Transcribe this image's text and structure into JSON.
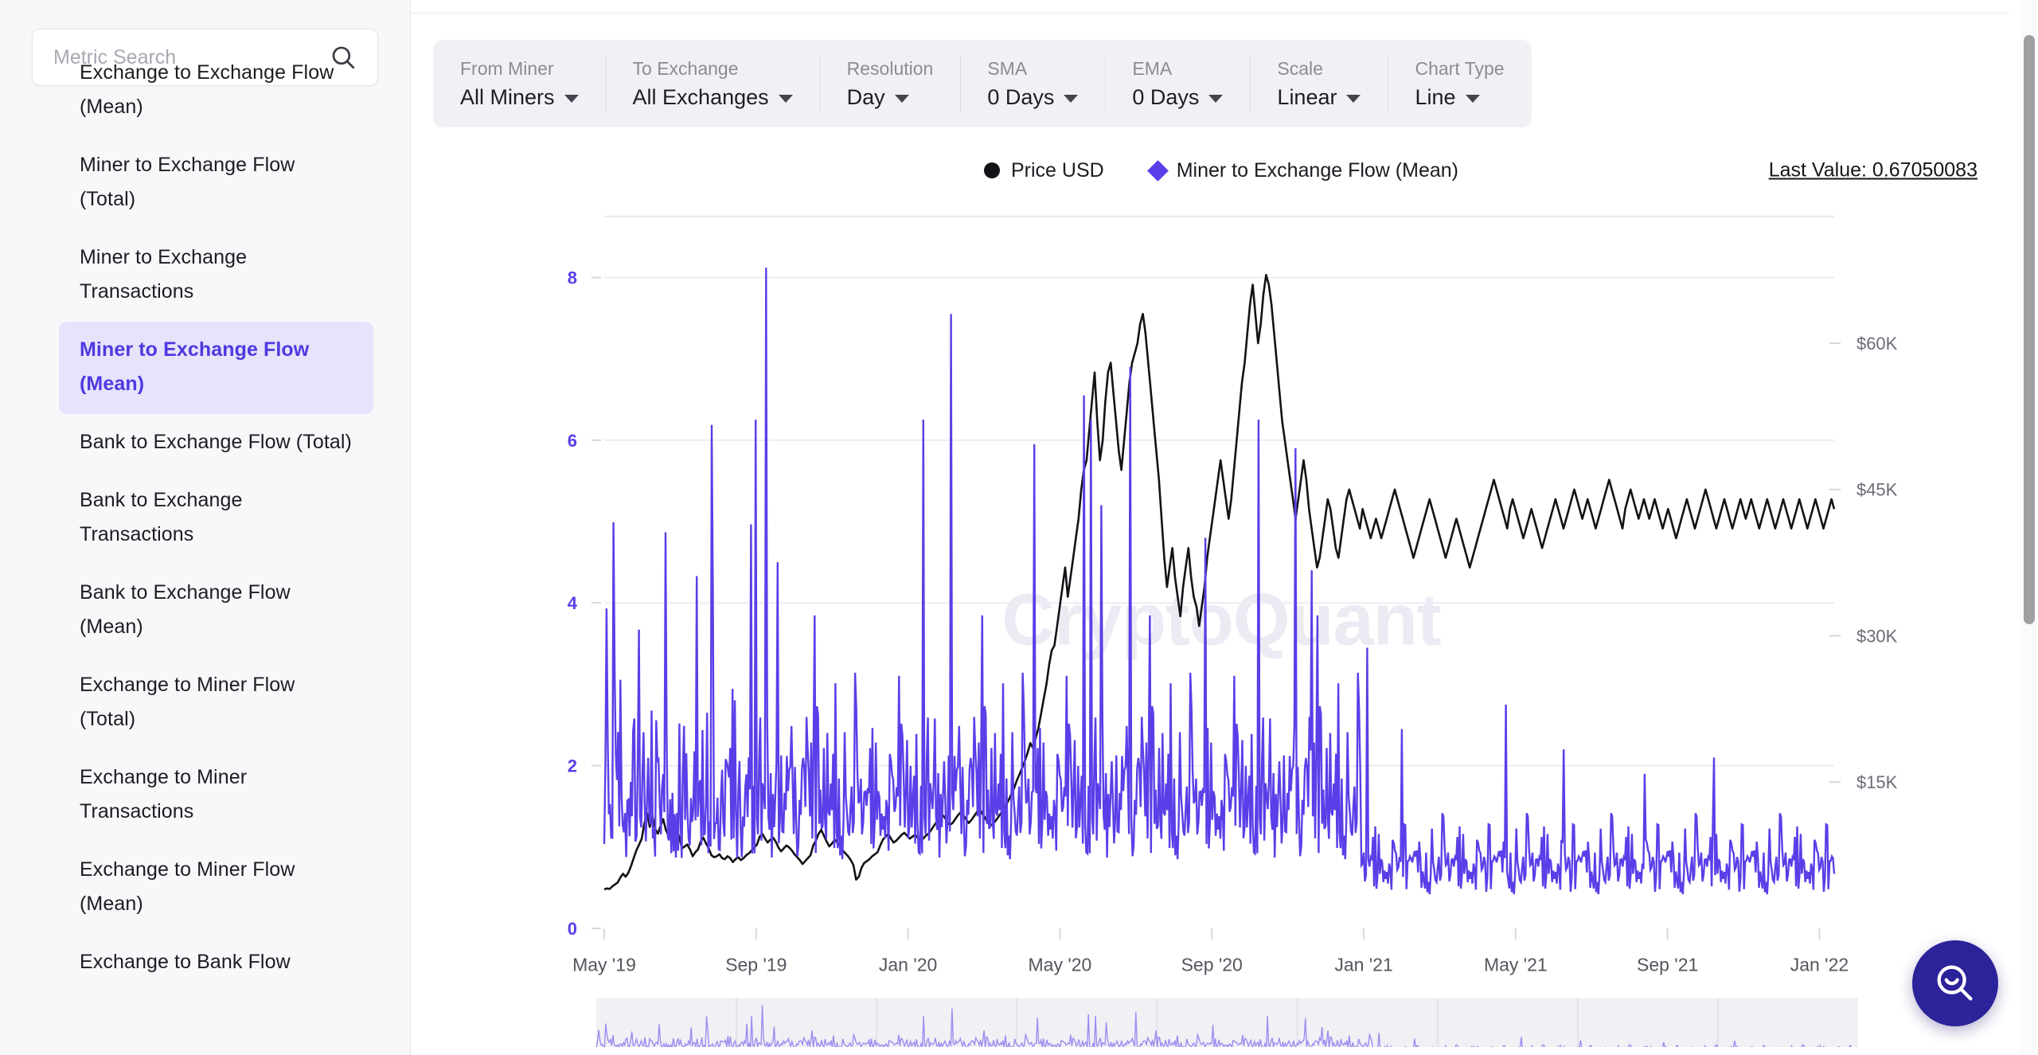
{
  "sidebar": {
    "search": {
      "placeholder": "Metric Search",
      "value": "",
      "icon": "search-icon"
    },
    "items": [
      {
        "label": "Exchange to Exchange Flow (Mean)",
        "selected": false,
        "clipped": true
      },
      {
        "label": "Miner to Exchange Flow (Total)",
        "selected": false
      },
      {
        "label": "Miner to Exchange Transactions",
        "selected": false
      },
      {
        "label": "Miner to Exchange Flow (Mean)",
        "selected": true
      },
      {
        "label": "Bank to Exchange Flow (Total)",
        "selected": false
      },
      {
        "label": "Bank to Exchange Transactions",
        "selected": false
      },
      {
        "label": "Bank to Exchange Flow (Mean)",
        "selected": false
      },
      {
        "label": "Exchange to Miner Flow (Total)",
        "selected": false
      },
      {
        "label": "Exchange to Miner Transactions",
        "selected": false
      },
      {
        "label": "Exchange to Miner Flow (Mean)",
        "selected": false
      },
      {
        "label": "Exchange to Bank Flow",
        "selected": false
      }
    ]
  },
  "toolbar": {
    "controls": [
      {
        "label": "From Miner",
        "value": "All Miners"
      },
      {
        "label": "To Exchange",
        "value": "All Exchanges"
      },
      {
        "label": "Resolution",
        "value": "Day"
      },
      {
        "label": "SMA",
        "value": "0 Days"
      },
      {
        "label": "EMA",
        "value": "0 Days"
      },
      {
        "label": "Scale",
        "value": "Linear"
      },
      {
        "label": "Chart Type",
        "value": "Line"
      }
    ]
  },
  "chart_header": {
    "legend": [
      {
        "name": "Price USD",
        "marker": "circle",
        "color": "#121217"
      },
      {
        "name": "Miner to Exchange Flow (Mean)",
        "marker": "diamond",
        "color": "#5b3ee8"
      }
    ],
    "last_value": "Last Value: 0.67050083",
    "watermark": "CryptoQuant"
  },
  "fab": {
    "icon": "search-smile-icon",
    "color": "#2c2299"
  },
  "chart_data": {
    "type": "line",
    "title": "",
    "subtitle": "",
    "xlabel": "",
    "grid": true,
    "legend_position": "top-center",
    "x_ticks": [
      "May '19",
      "Sep '19",
      "Jan '20",
      "May '20",
      "Sep '20",
      "Jan '21",
      "May '21",
      "Sep '21",
      "Jan '22"
    ],
    "x_tick_positions": [
      0.0,
      0.1235,
      0.247,
      0.3705,
      0.494,
      0.6175,
      0.741,
      0.8645,
      0.988
    ],
    "axes": [
      {
        "side": "left",
        "label": "Miner to Exchange Flow (Mean)",
        "ticks": [
          0,
          2,
          4,
          6,
          8
        ],
        "ylim": [
          0,
          8.75
        ],
        "color": "#5b3ee8"
      },
      {
        "side": "right",
        "label": "Price USD",
        "ticks": [
          "$15K",
          "$30K",
          "$45K",
          "$60K"
        ],
        "tick_values": [
          15000,
          30000,
          45000,
          60000
        ],
        "ylim": [
          0,
          73000
        ],
        "color": "#6b6b78"
      }
    ],
    "series": [
      {
        "name": "Price USD",
        "axis": "right",
        "color": "#121217",
        "marker": "circle",
        "type": "line",
        "values": [
          4000,
          4100,
          4050,
          4300,
          4500,
          4700,
          5200,
          5600,
          5300,
          5700,
          6400,
          7200,
          8000,
          8600,
          9200,
          10800,
          11800,
          10400,
          11500,
          10200,
          9700,
          10500,
          11200,
          10100,
          9500,
          10300,
          9900,
          10100,
          9400,
          8200,
          8400,
          8600,
          8100,
          7400,
          7800,
          8100,
          8900,
          9300,
          8700,
          8200,
          7500,
          7300,
          7400,
          7600,
          7200,
          7100,
          7400,
          7200,
          6800,
          7100,
          7300,
          7000,
          7200,
          7500,
          7700,
          8000,
          8300,
          8600,
          9400,
          9700,
          9200,
          8800,
          9100,
          9300,
          8900,
          8300,
          7900,
          8200,
          8500,
          8300,
          8000,
          7600,
          7300,
          7000,
          6600,
          6900,
          7200,
          7500,
          8500,
          9000,
          9700,
          10100,
          9500,
          8900,
          8400,
          8700,
          9100,
          8800,
          8500,
          8000,
          7700,
          7400,
          7000,
          6500,
          5000,
          5300,
          6200,
          6700,
          6900,
          7100,
          7400,
          7600,
          7800,
          8500,
          9100,
          9400,
          9700,
          9200,
          8800,
          9000,
          9300,
          9600,
          9800,
          9500,
          9200,
          9400,
          9600,
          9300,
          9100,
          9200,
          9500,
          9700,
          10100,
          10500,
          10900,
          11300,
          11700,
          11400,
          10900,
          10600,
          10800,
          11200,
          11600,
          11900,
          11600,
          11200,
          10800,
          11100,
          11500,
          11900,
          12300,
          11800,
          11400,
          10900,
          10500,
          10700,
          11000,
          11400,
          11800,
          12200,
          12700,
          13200,
          13800,
          14400,
          15200,
          15800,
          16500,
          17200,
          18000,
          19000,
          18500,
          19500,
          20500,
          22000,
          23500,
          25000,
          27000,
          28500,
          29000,
          31000,
          33000,
          35000,
          37000,
          34000,
          36000,
          38000,
          40000,
          42000,
          45000,
          47000,
          48000,
          51000,
          54000,
          57000,
          52000,
          48000,
          50000,
          54000,
          57000,
          58000,
          55000,
          52000,
          49000,
          47000,
          50000,
          53000,
          56000,
          58000,
          59000,
          60000,
          62000,
          63000,
          61000,
          58000,
          55000,
          52000,
          49000,
          46000,
          42000,
          38000,
          35000,
          37000,
          39000,
          36000,
          34000,
          32000,
          35000,
          37000,
          39000,
          36000,
          34000,
          33000,
          31000,
          33000,
          35000,
          38000,
          40000,
          42000,
          44000,
          46000,
          48000,
          46000,
          44000,
          42000,
          44000,
          47000,
          50000,
          53000,
          56000,
          58000,
          61000,
          64000,
          66000,
          63000,
          60000,
          62000,
          65000,
          67000,
          66000,
          64000,
          61000,
          58000,
          55000,
          52000,
          50000,
          48000,
          46000,
          44000,
          42000,
          44000,
          46000,
          48000,
          46000,
          43000,
          41000,
          39000,
          37000,
          38000,
          40000,
          42000,
          44000,
          43000,
          41000,
          39000,
          38000,
          40000,
          42000,
          44000,
          45000,
          44000,
          43000,
          42000,
          41000,
          43000,
          42000,
          41000,
          40000,
          41000,
          42000,
          41000,
          40000,
          41000,
          42000,
          43000,
          44000,
          45000,
          44000,
          43000,
          42000,
          41000,
          40000,
          39000,
          38000,
          39000,
          40000,
          41000,
          42000,
          43000,
          44000,
          43000,
          42000,
          41000,
          40000,
          39000,
          38000,
          39000,
          40000,
          41000,
          42000,
          41000,
          40000,
          39000,
          38000,
          37000,
          38000,
          39000,
          40000,
          41000,
          42000,
          43000,
          44000,
          45000,
          46000,
          45000,
          44000,
          43000,
          42000,
          41000,
          43000,
          44000,
          43000,
          42000,
          41000,
          40000,
          41000,
          42000,
          43000,
          42000,
          41000,
          40000,
          39000,
          40000,
          41000,
          42000,
          43000,
          44000,
          43000,
          42000,
          41000,
          42000,
          43000,
          44000,
          45000,
          44000,
          43000,
          42000,
          43000,
          44000,
          43000,
          42000,
          41000,
          42000,
          43000,
          44000,
          45000,
          46000,
          45000,
          44000,
          43000,
          42000,
          41000,
          43000,
          44000,
          45000,
          44000,
          43000,
          42000,
          43000,
          44000,
          43000,
          42000,
          43000,
          44000,
          43000,
          42000,
          41000,
          42000,
          43000,
          42000,
          41000,
          40000,
          41000,
          42000,
          43000,
          44000,
          43000,
          42000,
          41000,
          42000,
          43000,
          44000,
          45000,
          44000,
          43000,
          42000,
          41000,
          42000,
          43000,
          44000,
          43000,
          42000,
          41000,
          42000,
          43000,
          44000,
          43000,
          42000,
          43000,
          44000,
          43000,
          42000,
          41000,
          42000,
          43000,
          44000,
          43000,
          42000,
          41000,
          42000,
          43000,
          44000,
          43000,
          42000,
          41000,
          42000,
          43000,
          44000,
          43000,
          42000,
          41000,
          42000,
          43000,
          44000,
          43000,
          42000,
          41000,
          42000,
          43000,
          44000,
          43000
        ]
      },
      {
        "name": "Miner to Exchange Flow (Mean)",
        "axis": "left",
        "color": "#5b3ee8",
        "marker": "diamond",
        "type": "line",
        "description": "Daily mean miner-to-exchange flow in BTC. Noisy spiky series roughly 0.2-3 BTC through 2019-2020 with occasional spikes to 8.1, 7.5, 6.9, 6.5, 5.9, 5.5; drops sharply after Jan 2021 to a lower band of roughly 0.2-1.5 with rare spikes to 3.4, 2.7, 2.4.",
        "last_value": 0.67050083,
        "spikes": [
          {
            "x": "Jul '19",
            "y": 8.1
          },
          {
            "x": "Dec '19",
            "y": 7.5
          },
          {
            "x": "Apr '20",
            "y": 6.9
          },
          {
            "x": "Jan '20",
            "y": 6.5
          },
          {
            "x": "Mar '20",
            "y": 5.9
          },
          {
            "x": "Sep '20",
            "y": 5.9
          },
          {
            "x": "Jun '20",
            "y": 5.5
          },
          {
            "x": "Jun '21",
            "y": 3.4
          },
          {
            "x": "Oct '21",
            "y": 2.7
          }
        ]
      }
    ],
    "range_selector": {
      "visible": true,
      "selected_full": true
    }
  }
}
